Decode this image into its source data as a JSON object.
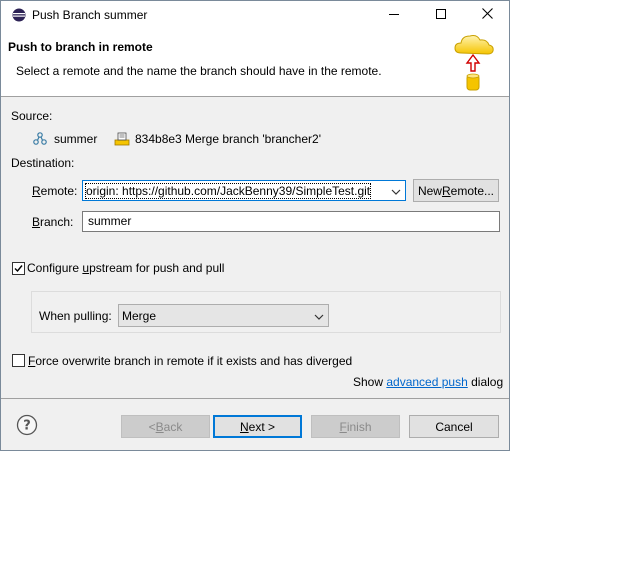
{
  "window": {
    "title": "Push Branch summer",
    "minimize_icon": "minimize-icon",
    "maximize_icon": "maximize-icon",
    "close_icon": "close-icon"
  },
  "banner": {
    "heading": "Push to branch in remote",
    "description": "Select a remote and the name the branch should have in the remote."
  },
  "source": {
    "label": "Source:",
    "branch_name": "summer",
    "commit_id": "834b8e3",
    "commit_message": "Merge branch 'brancher2'"
  },
  "destination": {
    "label": "Destination:",
    "remote_label_pre": "",
    "remote_label_u": "R",
    "remote_label_post": "emote:",
    "remote_value": "origin: https://github.com/JackBenny39/SimpleTest.git",
    "new_remote_pre": "New ",
    "new_remote_u": "R",
    "new_remote_post": "emote...",
    "branch_label_pre": "",
    "branch_label_u": "B",
    "branch_label_post": "ranch:",
    "branch_value": "summer"
  },
  "upstream": {
    "checked": true,
    "label_pre": "Configure ",
    "label_u": "u",
    "label_post": "pstream for push and pull",
    "when_pulling_label": "When pulling:",
    "when_pulling_value": "Merge"
  },
  "force": {
    "checked": false,
    "label_pre": "",
    "label_u": "F",
    "label_post": "orce overwrite branch in remote if it exists and has diverged"
  },
  "advanced": {
    "pre": "Show ",
    "link": "advanced push",
    "post": " dialog"
  },
  "buttons": {
    "back_pre": "< ",
    "back_u": "B",
    "back_post": "ack",
    "next_u": "N",
    "next_post": "ext >",
    "finish_u": "F",
    "finish_post": "inish",
    "cancel": "Cancel"
  },
  "colors": {
    "accent": "#0078d7",
    "link": "#0066cc"
  }
}
